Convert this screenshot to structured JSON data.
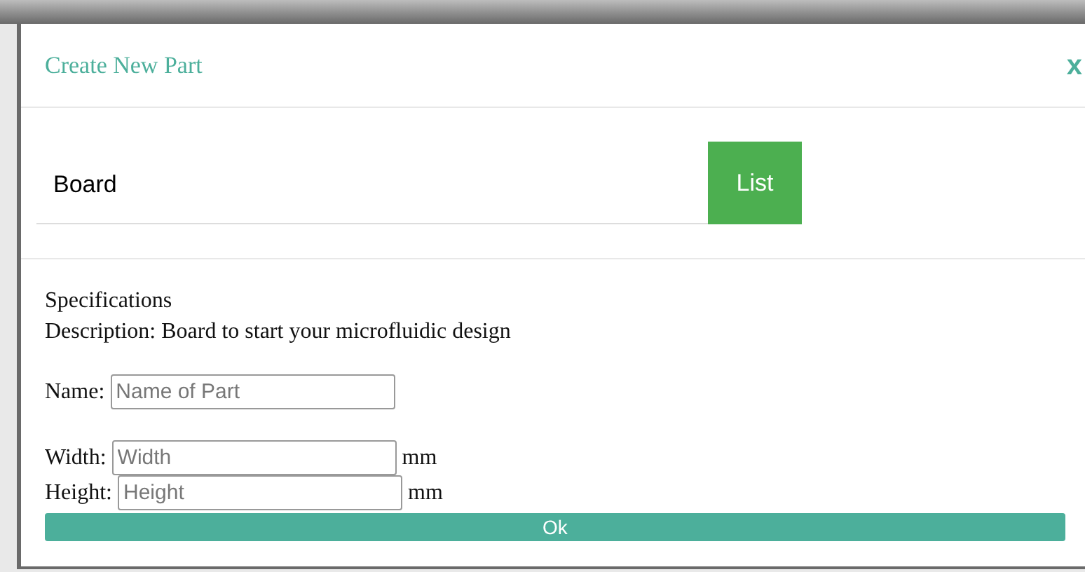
{
  "dialog": {
    "title": "Create New Part",
    "close": "x"
  },
  "search": {
    "value": "Board",
    "button": "List"
  },
  "specs": {
    "heading": "Specifications",
    "description": "Description: Board to start your microfluidic design"
  },
  "fields": [
    {
      "label": "Name:",
      "placeholder": "Name of Part"
    },
    {
      "label": "Width:",
      "placeholder": "Width",
      "unit": "mm"
    },
    {
      "label": "Height:",
      "placeholder": "Height",
      "unit": "mm"
    }
  ],
  "ok": "Ok"
}
